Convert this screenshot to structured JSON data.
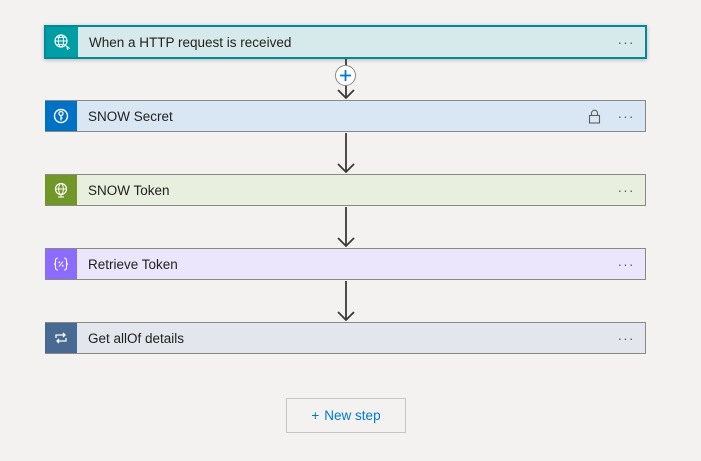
{
  "steps": [
    {
      "label": "When a HTTP request is received",
      "icon": "http-globe-icon",
      "icon_bg": "#009da5",
      "card_bg": "#d7eaeb",
      "more": "···"
    },
    {
      "label": "SNOW Secret",
      "icon": "key-vault-icon",
      "icon_bg": "#0072c6",
      "card_bg": "#d9e6f3",
      "more": "···",
      "locked": true
    },
    {
      "label": "SNOW Token",
      "icon": "globe-icon",
      "icon_bg": "#709727",
      "card_bg": "#e8efdf",
      "more": "···"
    },
    {
      "label": "Retrieve Token",
      "icon": "parse-json-icon",
      "icon_bg": "#8c6cff",
      "card_bg": "#ebe6fb",
      "more": "···"
    },
    {
      "label": "Get allOf details",
      "icon": "loop-icon",
      "icon_bg": "#486991",
      "card_bg": "#e3e6ec",
      "more": "···"
    }
  ],
  "new_step": {
    "plus": "+",
    "label": "New step"
  },
  "colors": {
    "accent": "#0078d4",
    "selected_border": "#008a99"
  }
}
